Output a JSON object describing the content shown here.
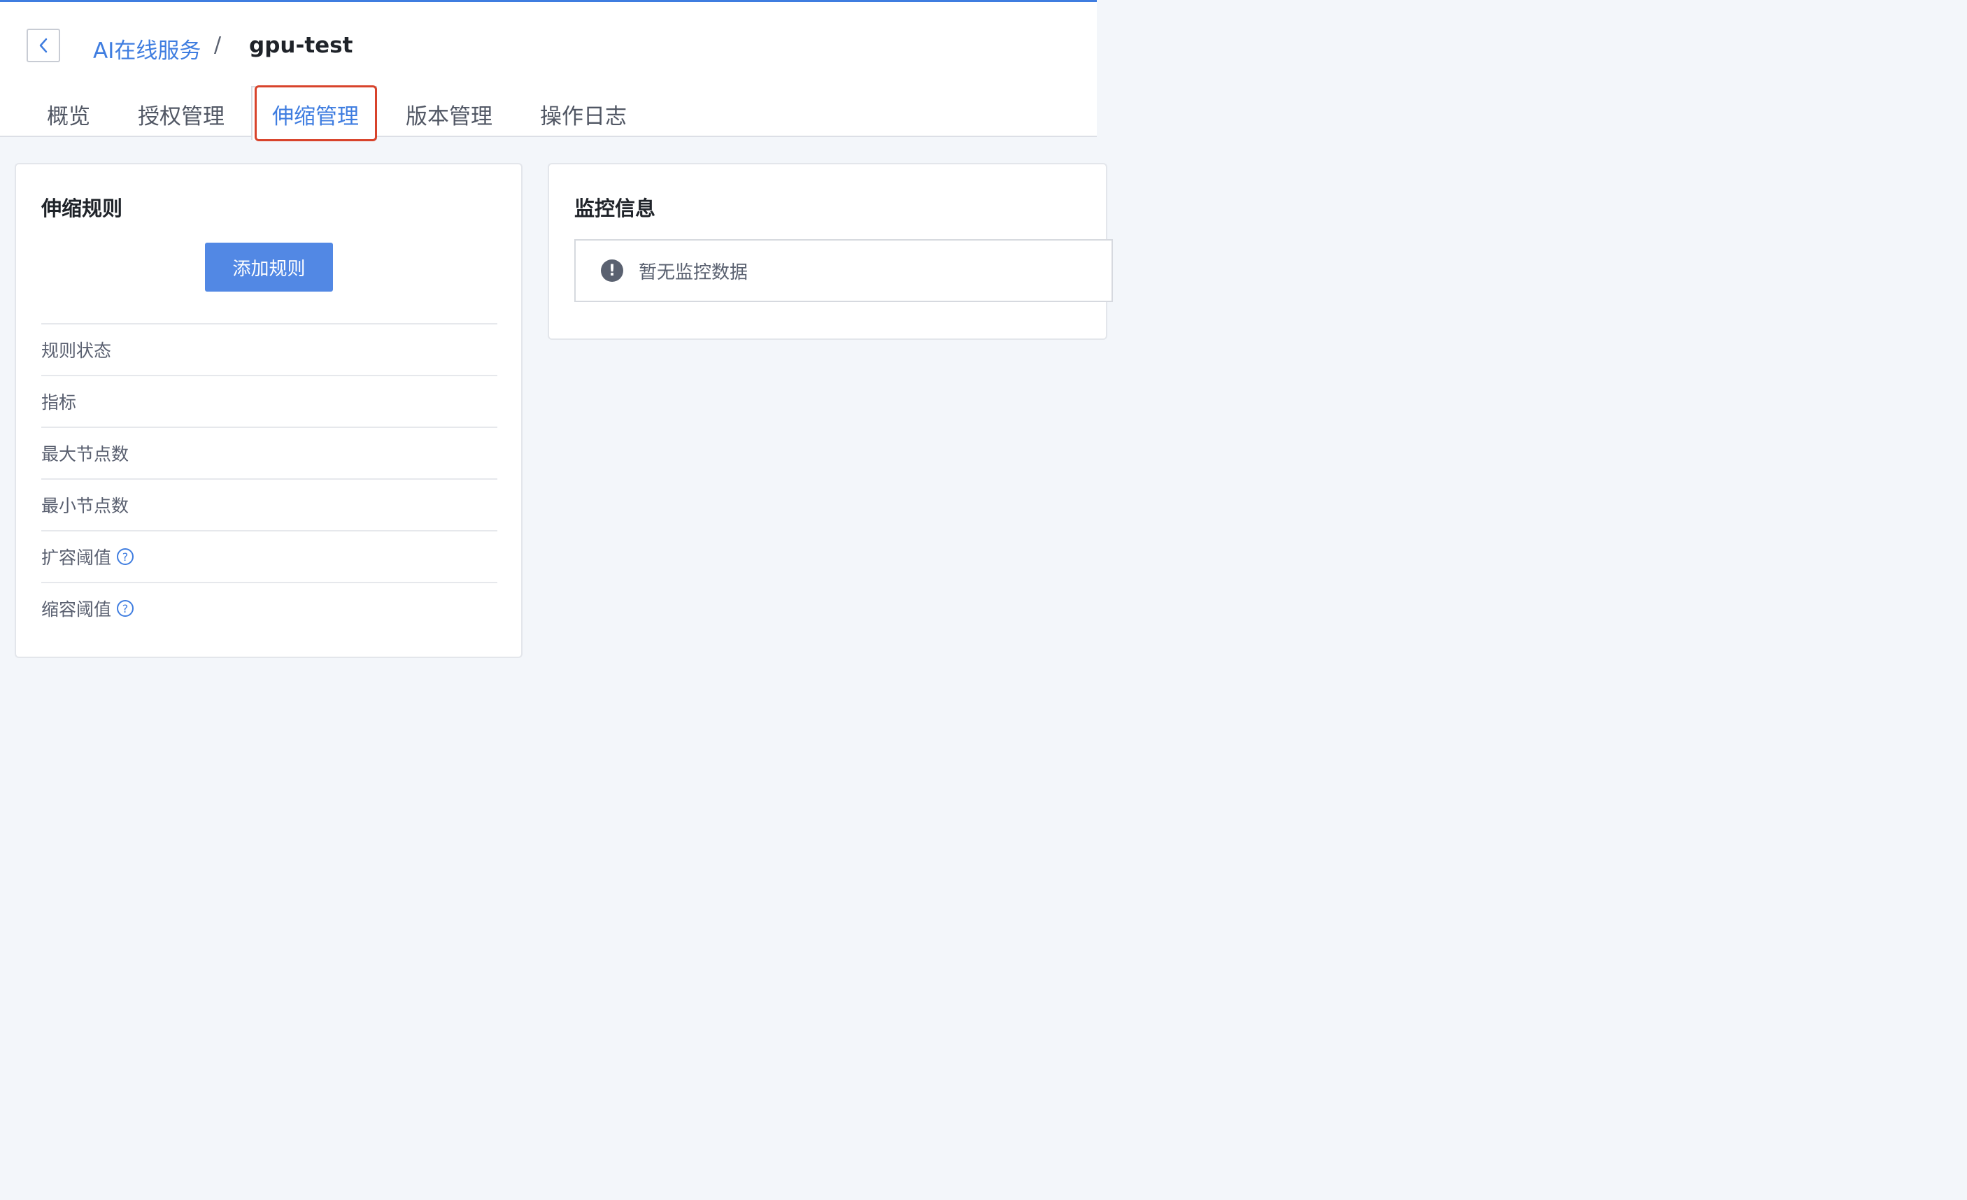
{
  "breadcrumb": {
    "parent": "AI在线服务",
    "separator": "/",
    "current": "gpu-test"
  },
  "tabs": [
    {
      "label": "概览"
    },
    {
      "label": "授权管理"
    },
    {
      "label": "伸缩管理",
      "active": true
    },
    {
      "label": "版本管理"
    },
    {
      "label": "操作日志"
    }
  ],
  "scaling_rules": {
    "title": "伸缩规则",
    "add_button": "添加规则",
    "rows": [
      {
        "label": "规则状态"
      },
      {
        "label": "指标"
      },
      {
        "label": "最大节点数"
      },
      {
        "label": "最小节点数"
      },
      {
        "label": "扩容阈值",
        "help_icon": "question-icon"
      },
      {
        "label": "缩容阈值",
        "help_icon": "question-icon"
      }
    ]
  },
  "monitoring": {
    "title": "监控信息",
    "empty_text": "暂无监控数据",
    "empty_icon": "exclamation-icon"
  },
  "colors": {
    "accent": "#3f7de0",
    "button": "#5288e4",
    "highlight": "#d8432b"
  }
}
